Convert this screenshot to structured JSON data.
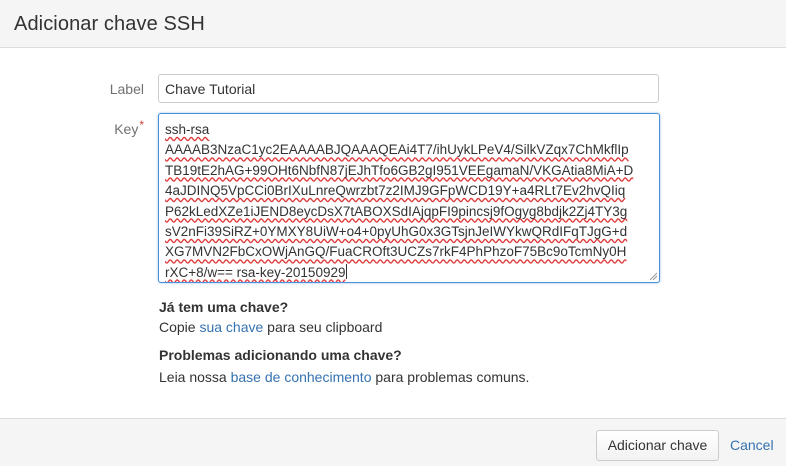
{
  "dialog": {
    "title": "Adicionar chave SSH"
  },
  "form": {
    "label_field_label": "Label",
    "label_value": "Chave Tutorial",
    "key_field_label": "Key",
    "required_mark": "*",
    "key_lines": [
      "ssh-rsa",
      "AAAAB3NzaC1yc2EAAAABJQAAAQEAi4T7/ihUykLPeV4/SilkVZqx7ChMkflIp",
      "TB19tE2hAG+99OHt6NbfN87jEJhTfo6GB2gI951VEEgamaN/VKGAtia8MiA+D",
      "4aJDINQ5VpCCi0BrIXuLnreQwrzbt7z2IMJ9GFpWCD19Y+a4RLt7Ev2hvQIiq",
      "P62kLedXZe1iJEND8eycDsX7tABOXSdIAjqpFI9pincsj9fOgyg8bdjk2Zj4TY3g",
      "sV2nFi39SiRZ+0YMXY8UiW+o4+0pyUhG0x3GTsjnJeIWYkwQRdIFqTJgG+d",
      "XG7MVN2FbCxOWjAnGQ/FuaCROft3UCZs7rkF4PhPhzoF75Bc9oTcmNy0H",
      "rXC+8/w== rsa-key-20150929"
    ]
  },
  "help": {
    "existing_title": "Já tem uma chave?",
    "existing_prefix": "Copie ",
    "existing_link": "sua chave",
    "existing_suffix": " para seu clipboard",
    "problems_title": "Problemas adicionando uma chave?",
    "problems_prefix": "Leia nossa ",
    "problems_link": "base de conhecimento",
    "problems_suffix": " para problemas comuns."
  },
  "footer": {
    "submit_label": "Adicionar chave",
    "cancel_label": "Cancel"
  },
  "colors": {
    "link": "#3572b0",
    "required": "#d04437",
    "focus_border": "#4a90d9"
  }
}
